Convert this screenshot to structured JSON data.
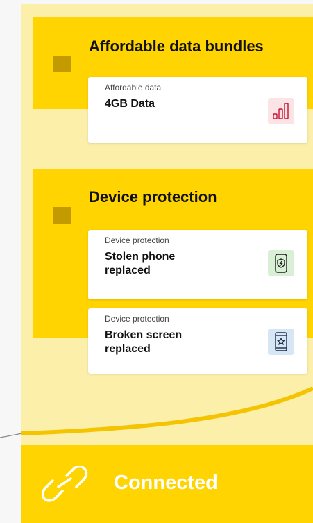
{
  "sections": [
    {
      "title": "Affordable data bundles",
      "cards": [
        {
          "kicker": "Affordable data",
          "title": "4GB Data",
          "icon": "signal-bars-icon"
        }
      ]
    },
    {
      "title": "Device protection",
      "cards": [
        {
          "kicker": "Device protection",
          "title": "Stolen phone replaced",
          "icon": "phone-shield-icon"
        },
        {
          "kicker": "Device protection",
          "title": "Broken screen replaced",
          "icon": "phone-star-icon"
        }
      ]
    }
  ],
  "footer": {
    "label": "Connected",
    "icon": "link-icon"
  },
  "colors": {
    "panel": "#fcefaa",
    "accent": "#ffd400",
    "square": "#c39a00",
    "data_icon_bg": "#fce3e6",
    "shield_icon_bg": "#d9f0d6",
    "star_icon_bg": "#d7e6f4"
  }
}
